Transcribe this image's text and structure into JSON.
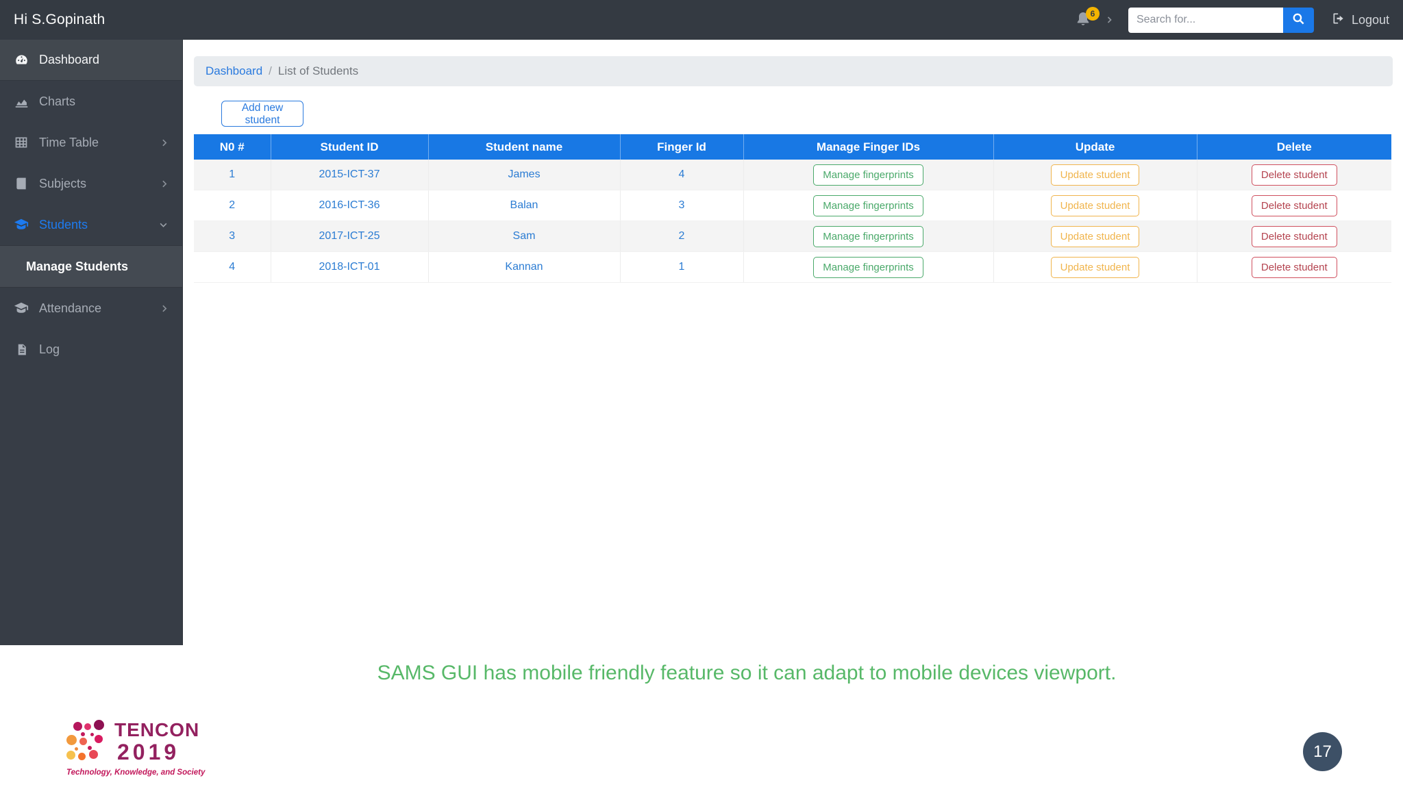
{
  "navbar": {
    "greeting": "Hi S.Gopinath",
    "notification_count": "6",
    "search": {
      "placeholder": "Search for..."
    },
    "logout_label": "Logout"
  },
  "sidebar": {
    "items": [
      {
        "label": "Dashboard",
        "icon": "dashboard-gauge-icon",
        "state": "active"
      },
      {
        "label": "Charts",
        "icon": "chart-area-icon"
      },
      {
        "label": "Time Table",
        "icon": "table-grid-icon",
        "chevron": "right"
      },
      {
        "label": "Subjects",
        "icon": "book-icon",
        "chevron": "right"
      },
      {
        "label": "Students",
        "icon": "graduation-cap-icon",
        "chevron": "down",
        "state": "expanded-accent"
      },
      {
        "label": "Manage Students",
        "type": "submenu-item"
      },
      {
        "label": "Attendance",
        "icon": "graduation-cap-icon",
        "chevron": "right"
      },
      {
        "label": "Log",
        "icon": "file-lines-icon"
      }
    ]
  },
  "breadcrumb": {
    "link": "Dashboard",
    "separator": "/",
    "current": "List of Students"
  },
  "toolbar": {
    "add_student_label": "Add new student"
  },
  "table": {
    "headers": [
      "N0 #",
      "Student ID",
      "Student name",
      "Finger Id",
      "Manage Finger IDs",
      "Update",
      "Delete"
    ],
    "actions": {
      "manage": "Manage fingerprints",
      "update": "Update student",
      "delete": "Delete student"
    },
    "rows": [
      {
        "no": "1",
        "student_id": "2015-ICT-37",
        "student_name": "James",
        "finger_id": "4"
      },
      {
        "no": "2",
        "student_id": "2016-ICT-36",
        "student_name": "Balan",
        "finger_id": "3"
      },
      {
        "no": "3",
        "student_id": "2017-ICT-25",
        "student_name": "Sam",
        "finger_id": "2"
      },
      {
        "no": "4",
        "student_id": "2018-ICT-01",
        "student_name": "Kannan",
        "finger_id": "1"
      }
    ]
  },
  "caption": "SAMS GUI has mobile friendly feature so it can adapt to mobile devices viewport.",
  "footer": {
    "logo": {
      "line1": "TENCON",
      "line2": "2019",
      "tagline": "Technology, Knowledge, and Society"
    },
    "page_number": "17"
  },
  "colors": {
    "navbar_dark": "#343a42",
    "sidebar_dark": "#373d46",
    "accent_blue": "#1a78e8",
    "link_blue": "#2b7cd3",
    "success_green": "#4aa96a",
    "warning_yellow": "#f0b44c",
    "danger_red": "#cf4f5e",
    "caption_green": "#57b868",
    "badge_yellow": "#f4b400",
    "tencon_purple": "#93215f",
    "tencon_crimson": "#c2185b",
    "page_circle": "#3d5066"
  }
}
